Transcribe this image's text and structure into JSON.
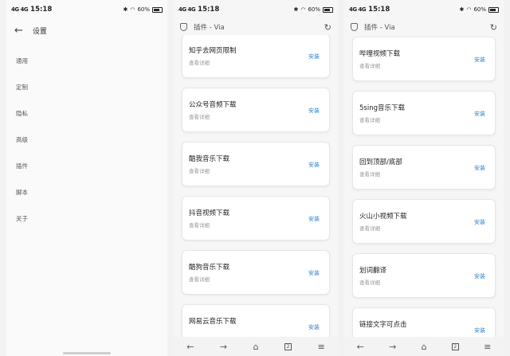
{
  "status": {
    "signal": "4G 4G",
    "time": "15:18",
    "battery": "60%"
  },
  "settings": {
    "title": "设置",
    "items": [
      "通用",
      "定制",
      "隐私",
      "高级",
      "插件",
      "脚本",
      "关于"
    ]
  },
  "via_header": {
    "title": "插件 - Via"
  },
  "screen2": {
    "plugins": [
      {
        "name": "知乎去网页限制",
        "detail": "查看详细",
        "action": "安装"
      },
      {
        "name": "公众号音频下载",
        "detail": "查看详细",
        "action": "安装"
      },
      {
        "name": "酷我音乐下载",
        "detail": "查看详细",
        "action": "安装"
      },
      {
        "name": "抖音视频下载",
        "detail": "查看详细",
        "action": "安装"
      },
      {
        "name": "酷狗音乐下载",
        "detail": "查看详细",
        "action": "安装"
      },
      {
        "name": "网易云音乐下载",
        "detail": "",
        "action": "安装"
      }
    ]
  },
  "screen3": {
    "plugins": [
      {
        "name": "哔哩视频下载",
        "detail": "查看详细",
        "action": "安装"
      },
      {
        "name": "5sing音乐下载",
        "detail": "查看详细",
        "action": "安装"
      },
      {
        "name": "回到顶部/底部",
        "detail": "查看详细",
        "action": "安装"
      },
      {
        "name": "火山小视频下载",
        "detail": "查看详细",
        "action": "安装"
      },
      {
        "name": "划词翻译",
        "detail": "查看详细",
        "action": "安装"
      },
      {
        "name": "链接文字可点击",
        "detail": "",
        "action": "安装"
      }
    ]
  },
  "bottom_bar": {
    "tabs_count": "2"
  },
  "colors": {
    "accent": "#2f80c8",
    "background": "#f6f6f6"
  }
}
